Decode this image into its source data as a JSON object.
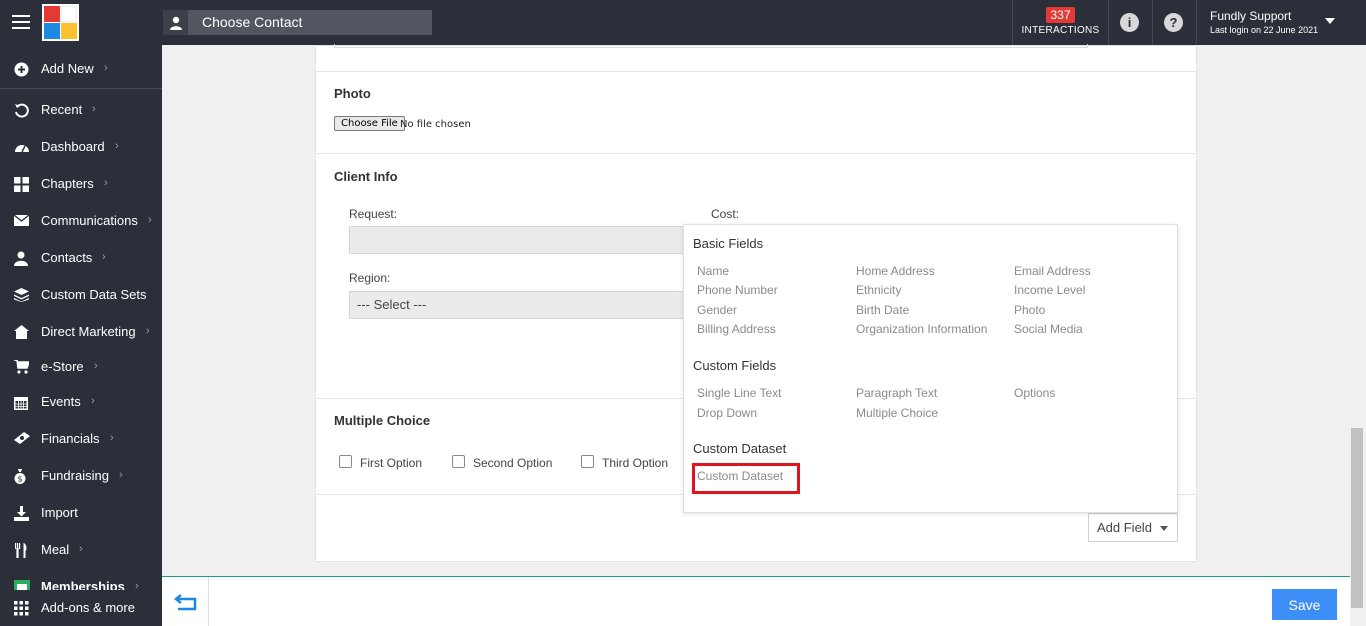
{
  "topbar": {
    "contact_placeholder": "Choose Contact",
    "interactions_count": "337",
    "interactions_label": "INTERACTIONS",
    "user_name": "Fundly Support",
    "last_login": "Last login on 22 June 2021"
  },
  "sidebar": {
    "items": [
      {
        "label": "Add New",
        "icon": "plus-circle-icon",
        "chevron": true
      },
      {
        "label": "Recent",
        "icon": "history-icon",
        "chevron": true
      },
      {
        "label": "Dashboard",
        "icon": "dashboard-gauge-icon",
        "chevron": true
      },
      {
        "label": "Chapters",
        "icon": "grid-icon",
        "chevron": true
      },
      {
        "label": "Communications",
        "icon": "envelope-icon",
        "chevron": true
      },
      {
        "label": "Contacts",
        "icon": "person-icon",
        "chevron": true
      },
      {
        "label": "Custom Data Sets",
        "icon": "layers-icon",
        "chevron": false
      },
      {
        "label": "Direct Marketing",
        "icon": "home-icon",
        "chevron": true
      },
      {
        "label": "e-Store",
        "icon": "cart-icon",
        "chevron": true
      },
      {
        "label": "Events",
        "icon": "calendar-icon",
        "chevron": true
      },
      {
        "label": "Financials",
        "icon": "money-icon",
        "chevron": true
      },
      {
        "label": "Fundraising",
        "icon": "moneybag-icon",
        "chevron": true
      },
      {
        "label": "Import",
        "icon": "import-icon",
        "chevron": false
      },
      {
        "label": "Meal",
        "icon": "utensils-icon",
        "chevron": true
      },
      {
        "label": "Memberships",
        "icon": "membership-icon",
        "chevron": true
      }
    ],
    "bottom_label": "Add-ons & more"
  },
  "form": {
    "photo_title": "Photo",
    "choose_file": "Choose File",
    "no_file": "No file chosen",
    "client_info_title": "Client Info",
    "request_label": "Request:",
    "cost_label": "Cost:",
    "region_label": "Region:",
    "region_value": "--- Select ---",
    "multiple_choice_title": "Multiple Choice",
    "options": [
      "First Option",
      "Second Option",
      "Third Option"
    ],
    "add_field_label": "Add Field"
  },
  "popup": {
    "basic_title": "Basic Fields",
    "basic_fields": [
      "Name",
      "Home Address",
      "Email Address",
      "Phone Number",
      "Ethnicity",
      "Income Level",
      "Gender",
      "Birth Date",
      "Photo",
      "Billing Address",
      "Organization Information",
      "Social Media"
    ],
    "custom_title": "Custom Fields",
    "custom_fields": [
      "Single Line Text",
      "Paragraph Text",
      "Options",
      "Drop Down",
      "Multiple Choice"
    ],
    "dataset_title": "Custom Dataset",
    "dataset_item": "Custom Dataset",
    "highlight_color": "#e0141e"
  },
  "bottombar": {
    "save_label": "Save"
  }
}
